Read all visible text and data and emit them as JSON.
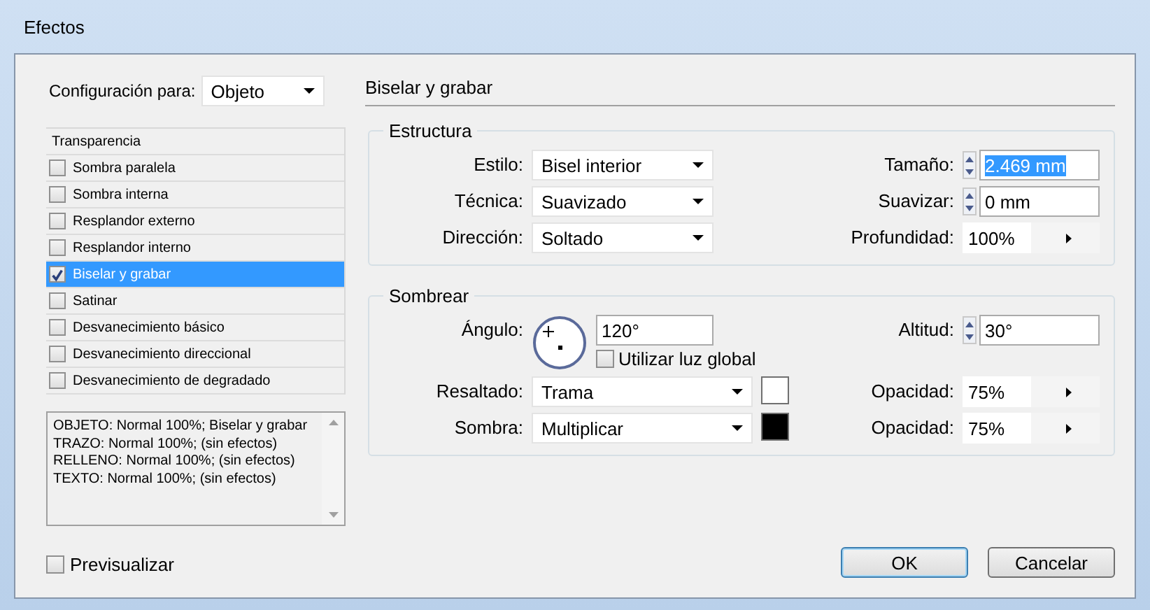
{
  "window": {
    "title": "Efectos"
  },
  "config": {
    "label": "Configuración para:",
    "value": "Objeto"
  },
  "effects_list": {
    "header": "Transparencia",
    "items": [
      {
        "label": "Sombra paralela",
        "checked": false,
        "selected": false
      },
      {
        "label": "Sombra interna",
        "checked": false,
        "selected": false
      },
      {
        "label": "Resplandor externo",
        "checked": false,
        "selected": false
      },
      {
        "label": "Resplandor interno",
        "checked": false,
        "selected": false
      },
      {
        "label": "Biselar y grabar",
        "checked": true,
        "selected": true
      },
      {
        "label": "Satinar",
        "checked": false,
        "selected": false
      },
      {
        "label": "Desvanecimiento básico",
        "checked": false,
        "selected": false
      },
      {
        "label": "Desvanecimiento direccional",
        "checked": false,
        "selected": false
      },
      {
        "label": "Desvanecimiento de degradado",
        "checked": false,
        "selected": false
      }
    ]
  },
  "summary": [
    "OBJETO: Normal 100%; Biselar y grabar",
    "TRAZO: Normal 100%; (sin efectos)",
    "RELLENO: Normal 100%; (sin efectos)",
    "TEXTO: Normal 100%; (sin efectos)"
  ],
  "section_title": "Biselar y grabar",
  "groups": [
    {
      "title": "Estructura",
      "rows": [
        {
          "left": {
            "kind": "dropdown",
            "label": "Estilo:",
            "value": "Bisel interior"
          },
          "right": {
            "kind": "spinner",
            "label": "Tamaño:",
            "value": "2.469 mm",
            "selected": true
          }
        },
        {
          "left": {
            "kind": "dropdown",
            "label": "Técnica:",
            "value": "Suavizado"
          },
          "right": {
            "kind": "spinner",
            "label": "Suavizar:",
            "value": "0 mm",
            "selected": false
          }
        },
        {
          "left": {
            "kind": "dropdown",
            "label": "Dirección:",
            "value": "Soltado"
          },
          "right": {
            "kind": "percent",
            "label": "Profundidad:",
            "value": "100%"
          }
        }
      ]
    },
    {
      "title": "Sombrear",
      "rows": [
        {
          "left": {
            "kind": "angle",
            "label": "Ángulo:",
            "value": "120°",
            "option": {
              "label": "Utilizar luz global",
              "checked": false
            }
          },
          "right": {
            "kind": "spinner",
            "label": "Altitud:",
            "value": "30°",
            "selected": false
          }
        },
        {
          "left": {
            "kind": "dropdown",
            "label": "Resaltado:",
            "value": "Trama",
            "color": "#ffffff"
          },
          "right": {
            "kind": "percent",
            "label": "Opacidad:",
            "value": "75%"
          }
        },
        {
          "left": {
            "kind": "dropdown",
            "label": "Sombra:",
            "value": "Multiplicar",
            "color": "#000000"
          },
          "right": {
            "kind": "percent",
            "label": "Opacidad:",
            "value": "75%"
          }
        }
      ]
    }
  ],
  "preview": {
    "label": "Previsualizar",
    "checked": false
  },
  "buttons": [
    "OK",
    "Cancelar"
  ]
}
